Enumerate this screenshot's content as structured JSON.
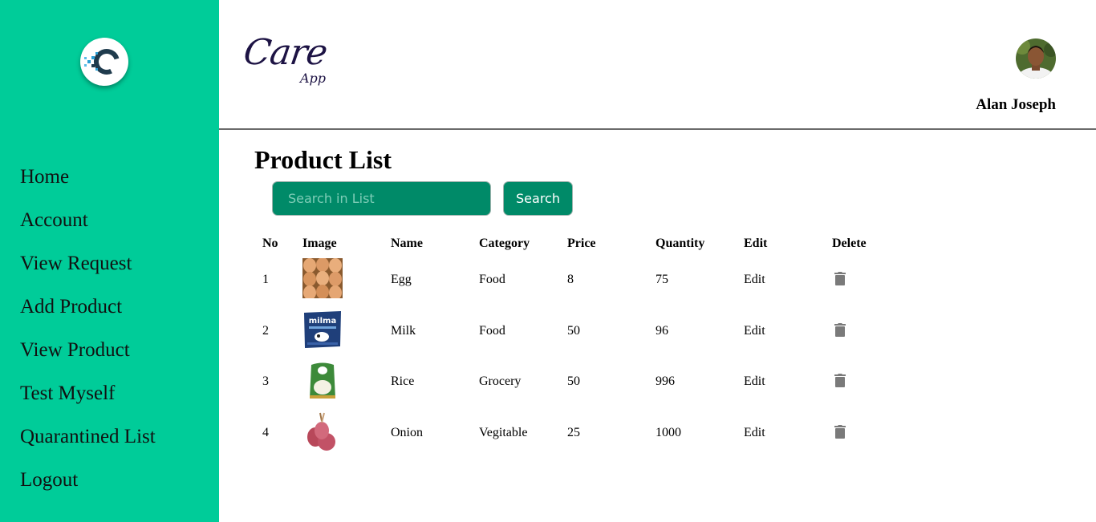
{
  "sidebar": {
    "logo_icon": "care-app-c-logo",
    "items": [
      {
        "label": "Home"
      },
      {
        "label": "Account"
      },
      {
        "label": "View Request"
      },
      {
        "label": "Add Product"
      },
      {
        "label": "View Product"
      },
      {
        "label": "Test Myself"
      },
      {
        "label": "Quarantined List"
      },
      {
        "label": "Logout"
      }
    ]
  },
  "header": {
    "brand_main": "Care",
    "brand_sub": "App",
    "user_name": "Alan Joseph"
  },
  "main": {
    "title": "Product List",
    "search": {
      "placeholder": "Search in List",
      "value": "",
      "button_label": "Search"
    },
    "table": {
      "headers": [
        "No",
        "Image",
        "Name",
        "Category",
        "Price",
        "Quantity",
        "Edit",
        "Delete"
      ],
      "rows": [
        {
          "no": "1",
          "image": "egg-image",
          "name": "Egg",
          "category": "Food",
          "price": "8",
          "quantity": "75",
          "edit": "Edit",
          "delete_icon": "trash-icon"
        },
        {
          "no": "2",
          "image": "milk-image",
          "name": "Milk",
          "category": "Food",
          "price": "50",
          "quantity": "96",
          "edit": "Edit",
          "delete_icon": "trash-icon"
        },
        {
          "no": "3",
          "image": "rice-image",
          "name": "Rice",
          "category": "Grocery",
          "price": "50",
          "quantity": "996",
          "edit": "Edit",
          "delete_icon": "trash-icon"
        },
        {
          "no": "4",
          "image": "onion-image",
          "name": "Onion",
          "category": "Vegitable",
          "price": "25",
          "quantity": "1000",
          "edit": "Edit",
          "delete_icon": "trash-icon"
        }
      ]
    }
  },
  "colors": {
    "sidebar_bg": "#00cc99",
    "button_bg": "#008a68",
    "brand_text": "#1d1344",
    "trash_icon": "#7a7a7a"
  }
}
